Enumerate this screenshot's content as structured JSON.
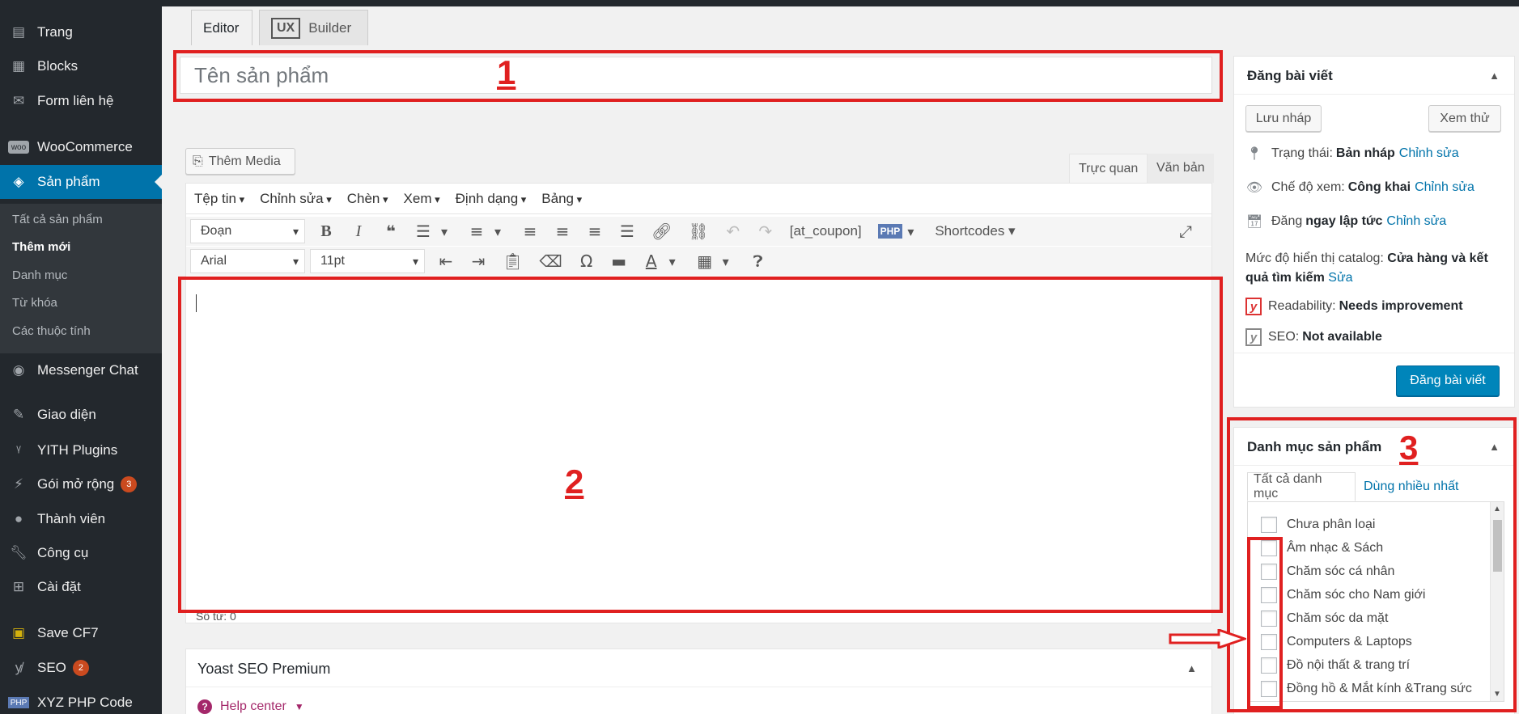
{
  "sidebar": {
    "items": [
      {
        "label": "Trang",
        "icon": "pages-icon"
      },
      {
        "label": "Blocks",
        "icon": "blocks-icon"
      },
      {
        "label": "Form liên hệ",
        "icon": "mail-icon"
      },
      {
        "label": "WooCommerce",
        "icon": "woocommerce-icon"
      },
      {
        "label": "Sản phẩm",
        "icon": "products-icon"
      },
      {
        "label": "Messenger Chat",
        "icon": "messenger-icon"
      },
      {
        "label": "Giao diện",
        "icon": "appearance-icon"
      },
      {
        "label": "YITH Plugins",
        "icon": "yith-icon"
      },
      {
        "label": "Gói mở rộng",
        "icon": "plugins-icon",
        "badge": "3"
      },
      {
        "label": "Thành viên",
        "icon": "users-icon"
      },
      {
        "label": "Công cụ",
        "icon": "tools-icon"
      },
      {
        "label": "Cài đặt",
        "icon": "settings-icon"
      },
      {
        "label": "Save CF7",
        "icon": "save-icon"
      },
      {
        "label": "SEO",
        "icon": "yoast-icon",
        "badge": "2"
      },
      {
        "label": "XYZ PHP Code",
        "icon": "php-icon"
      }
    ],
    "submenu": [
      "Tất cả sản phẩm",
      "Thêm mới",
      "Danh mục",
      "Từ khóa",
      "Các thuộc tính"
    ]
  },
  "tabs": {
    "editor": "Editor",
    "ux_logo": "UX",
    "ux_builder": "Builder"
  },
  "title_field": {
    "placeholder": "Tên sản phẩm"
  },
  "annotations": {
    "one": "1",
    "two": "2",
    "three": "3"
  },
  "editor": {
    "add_media": "Thêm Media",
    "mode_visual": "Trực quan",
    "mode_text": "Văn bản",
    "menus": [
      "Tệp tin",
      "Chỉnh sửa",
      "Chèn",
      "Xem",
      "Định dạng",
      "Bảng"
    ],
    "format_select": "Đoạn",
    "font_select": "Arial",
    "size_select": "11pt",
    "coupon_tag": "[at_coupon]",
    "php_tag": "PHP",
    "shortcodes": "Shortcodes",
    "word_count": "Số từ: 0"
  },
  "yoast": {
    "title": "Yoast SEO Premium",
    "help": "Help center"
  },
  "publish": {
    "title": "Đăng bài viết",
    "save_draft": "Lưu nháp",
    "preview": "Xem thử",
    "status_label": "Trạng thái:",
    "status_value": "Bản nháp",
    "visibility_label": "Chế độ xem:",
    "visibility_value": "Công khai",
    "schedule_label": "Đăng",
    "schedule_value": "ngay lập tức",
    "edit_link": "Chỉnh sửa",
    "catalog_label": "Mức độ hiển thị catalog:",
    "catalog_value": "Cửa hàng và kết quả tìm kiếm",
    "catalog_edit": "Sửa",
    "readability_label": "Readability:",
    "readability_value": "Needs improvement",
    "seo_label": "SEO:",
    "seo_value": "Not available",
    "publish_button": "Đăng bài viết"
  },
  "categories": {
    "title": "Danh mục sản phẩm",
    "tab_all": "Tất cả danh mục",
    "tab_popular": "Dùng nhiều nhất",
    "items": [
      "Chưa phân loại",
      "Âm nhạc & Sách",
      "Chăm sóc cá nhân",
      "Chăm sóc cho Nam giới",
      "Chăm sóc da mặt",
      "Computers & Laptops",
      "Đồ nội thất & trang trí",
      "Đồng hồ & Mắt kính &Trang sức"
    ]
  },
  "colors": {
    "accent": "#0073aa",
    "annotation_red": "#e02020",
    "sidebar_bg": "#23282d",
    "publish_btn": "#0085ba"
  }
}
